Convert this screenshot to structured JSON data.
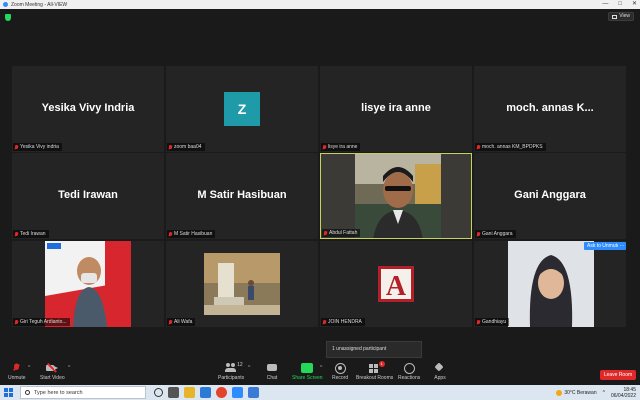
{
  "window": {
    "title": "Zoom Meeting - All-VIEW",
    "controls": [
      "—",
      "□",
      "✕"
    ]
  },
  "header": {
    "view_label": "View"
  },
  "tiles": [
    {
      "display": "Yesika Vivy Indria",
      "label": "Yesika Vivy indria"
    },
    {
      "display": "Z",
      "label": "zoom baa04"
    },
    {
      "display": "lisye ira anne",
      "label": "lisye ira anne"
    },
    {
      "display": "moch. annas K...",
      "label": "moch. annas KM_BPDPKS"
    },
    {
      "display": "Tedi Irawan",
      "label": "Tedi Irawan"
    },
    {
      "display": "M Satir Hasibuan",
      "label": "M Satir Hasibuan"
    },
    {
      "display": "",
      "label": "Abdul Fattah"
    },
    {
      "display": "Gani Anggara",
      "label": "Gani Anggara"
    },
    {
      "display": "",
      "label": "Giri Teguh Ardianto..."
    },
    {
      "display": "",
      "label": "Ali Wafa"
    },
    {
      "display": "",
      "label": "JOIN HENDRA"
    },
    {
      "display": "",
      "label": "Gandhiayu"
    }
  ],
  "ask_to_unmute": "Ask to Unmute",
  "more_btn": "...",
  "unassigned": "1 unassigned participant",
  "toolbar": {
    "unmute": "Unmute",
    "start_video": "Start Video",
    "participants": "Participants",
    "participants_count": "12",
    "chat": "Chat",
    "share_screen": "Share Screen",
    "record": "Record",
    "breakout_rooms": "Breakout Rooms",
    "breakout_badge": "1",
    "reactions": "Reactions",
    "apps": "Apps",
    "leave": "Leave Room"
  },
  "taskbar": {
    "search_placeholder": "Type here to search",
    "weather": "30°C  Berawan",
    "time": "18:45",
    "date": "06/04/2022"
  },
  "colors": {
    "accent": "#2d8cff",
    "active_speaker": "#c7d25a",
    "leave": "#e02828",
    "share": "#23d959"
  }
}
